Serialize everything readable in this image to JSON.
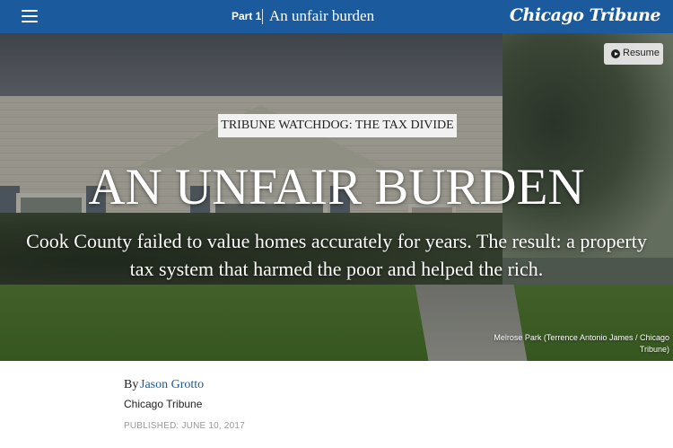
{
  "header": {
    "part_label": "Part 1",
    "part_title": "An unfair burden",
    "logo_text": "Chicago Tribune",
    "background_color": "#1b5a9c"
  },
  "hero": {
    "resume_label": "Resume",
    "kicker": "TRIBUNE WATCHDOG: THE TAX DIVIDE",
    "headline": "AN UNFAIR BURDEN",
    "dek": "Cook County failed to value homes accurately for years. The result: a property tax system that harmed the poor and helped the rich.",
    "photo_caption": "Melrose Park (Terrence Antonio James / Chicago Tribune)"
  },
  "byline": {
    "prefix": "By",
    "author": "Jason Grotto",
    "organization": "Chicago Tribune",
    "published": "PUBLISHED: JUNE 10, 2017",
    "author_link_color": "#1b5a9c"
  },
  "icons": {
    "menu": "hamburger-menu-icon",
    "resume": "play-circle-icon"
  }
}
